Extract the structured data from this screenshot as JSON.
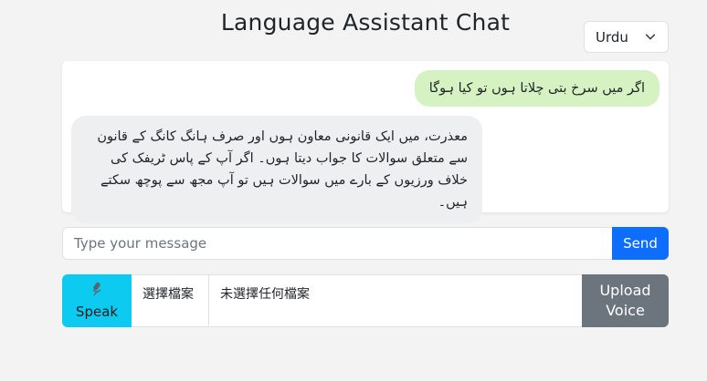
{
  "page": {
    "title": "Language Assistant Chat"
  },
  "language_select": {
    "selected": "Urdu",
    "icon": "chevron-down-icon"
  },
  "messages": [
    {
      "role": "user",
      "text": "اگر میں سرخ بتی چلاتا ہوں تو کیا ہوگا"
    },
    {
      "role": "assistant",
      "text": "معذرت، میں ایک قانونی معاون ہوں اور صرف ہانگ کانگ کے قانون سے متعلق سوالات کا جواب دیتا ہوں۔ اگر آپ کے پاس ٹریفک کی خلاف ورزیوں کے بارے میں سوالات ہیں تو آپ مجھ سے پوچھ سکتے ہیں۔"
    }
  ],
  "composer": {
    "placeholder": "Type your message",
    "value": "",
    "send_label": "Send"
  },
  "voice": {
    "speak_label": "Speak",
    "mic_icon": "microphone-icon",
    "choose_file_label": "選擇檔案",
    "file_status": "未選擇任何檔案",
    "upload_label_line1": "Upload",
    "upload_label_line2": "Voice"
  },
  "colors": {
    "user_bubble": "#d6f2c2",
    "assistant_bubble": "#eeeff0",
    "send": "#0d6efd",
    "speak": "#0dcaf0",
    "upload": "#6c757d"
  }
}
